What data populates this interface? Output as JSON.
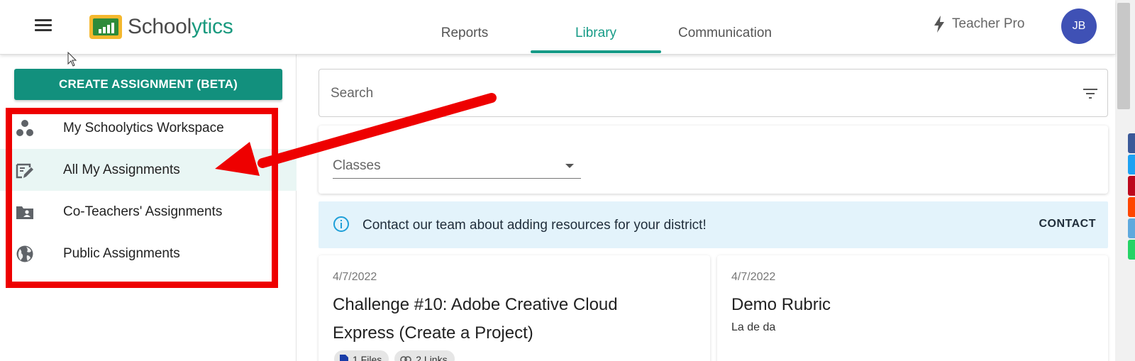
{
  "header": {
    "logo_prefix": "School",
    "logo_accent": "ytics",
    "tabs": [
      {
        "label": "Reports"
      },
      {
        "label": "Library"
      },
      {
        "label": "Communication"
      }
    ],
    "active_tab": "Library",
    "plan_label": "Teacher Pro",
    "avatar_initials": "JB"
  },
  "sidebar": {
    "create_button": "CREATE ASSIGNMENT (BETA)",
    "items": [
      {
        "label": "My Schoolytics Workspace",
        "icon": "workspace-icon"
      },
      {
        "label": "All My Assignments",
        "icon": "assignment-icon",
        "selected": true
      },
      {
        "label": "Co-Teachers' Assignments",
        "icon": "shared-folder-icon"
      },
      {
        "label": "Public Assignments",
        "icon": "globe-icon"
      }
    ]
  },
  "main": {
    "search": {
      "placeholder": "Search"
    },
    "filters": {
      "classes_label": "Classes"
    },
    "banner": {
      "message": "Contact our team about adding resources for your district!",
      "action": "CONTACT"
    },
    "cards": [
      {
        "date": "4/7/2022",
        "title_line1": "Challenge #10: Adobe Creative Cloud",
        "title_line2": "Express (Create a Project)",
        "chips": [
          "1 Files",
          "2 Links"
        ]
      },
      {
        "date": "4/7/2022",
        "title": "Demo Rubric",
        "description": "La de da"
      }
    ]
  },
  "colors": {
    "accent": "#179b87",
    "button": "#12907d",
    "avatar": "#3f51b5",
    "annotation": "#ee0000",
    "banner_bg": "#e3f3fb"
  },
  "share_colors": [
    "#3b5998",
    "#1da1f2",
    "#bd081c",
    "#ff4500",
    "#5fa9dd",
    "#25d366"
  ]
}
